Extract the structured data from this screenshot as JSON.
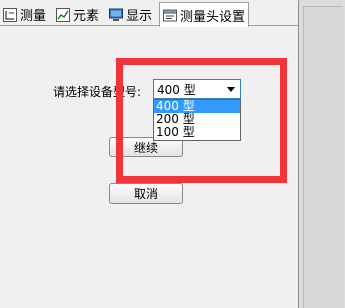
{
  "tabs": [
    {
      "label": "测量",
      "icon": "measure-icon"
    },
    {
      "label": "元素",
      "icon": "element-chart-icon"
    },
    {
      "label": "显示",
      "icon": "display-monitor-icon"
    },
    {
      "label": "测量头设置",
      "icon": "probe-settings-icon",
      "active": true
    }
  ],
  "form": {
    "model_label": "请选择设备型号:",
    "selected_model": "400 型",
    "options": [
      "400 型",
      "200 型",
      "100 型"
    ]
  },
  "buttons": {
    "continue_label": "继续",
    "cancel_label": "取消"
  },
  "colors": {
    "highlight_border": "#f0343a",
    "selection": "#3399ff"
  }
}
